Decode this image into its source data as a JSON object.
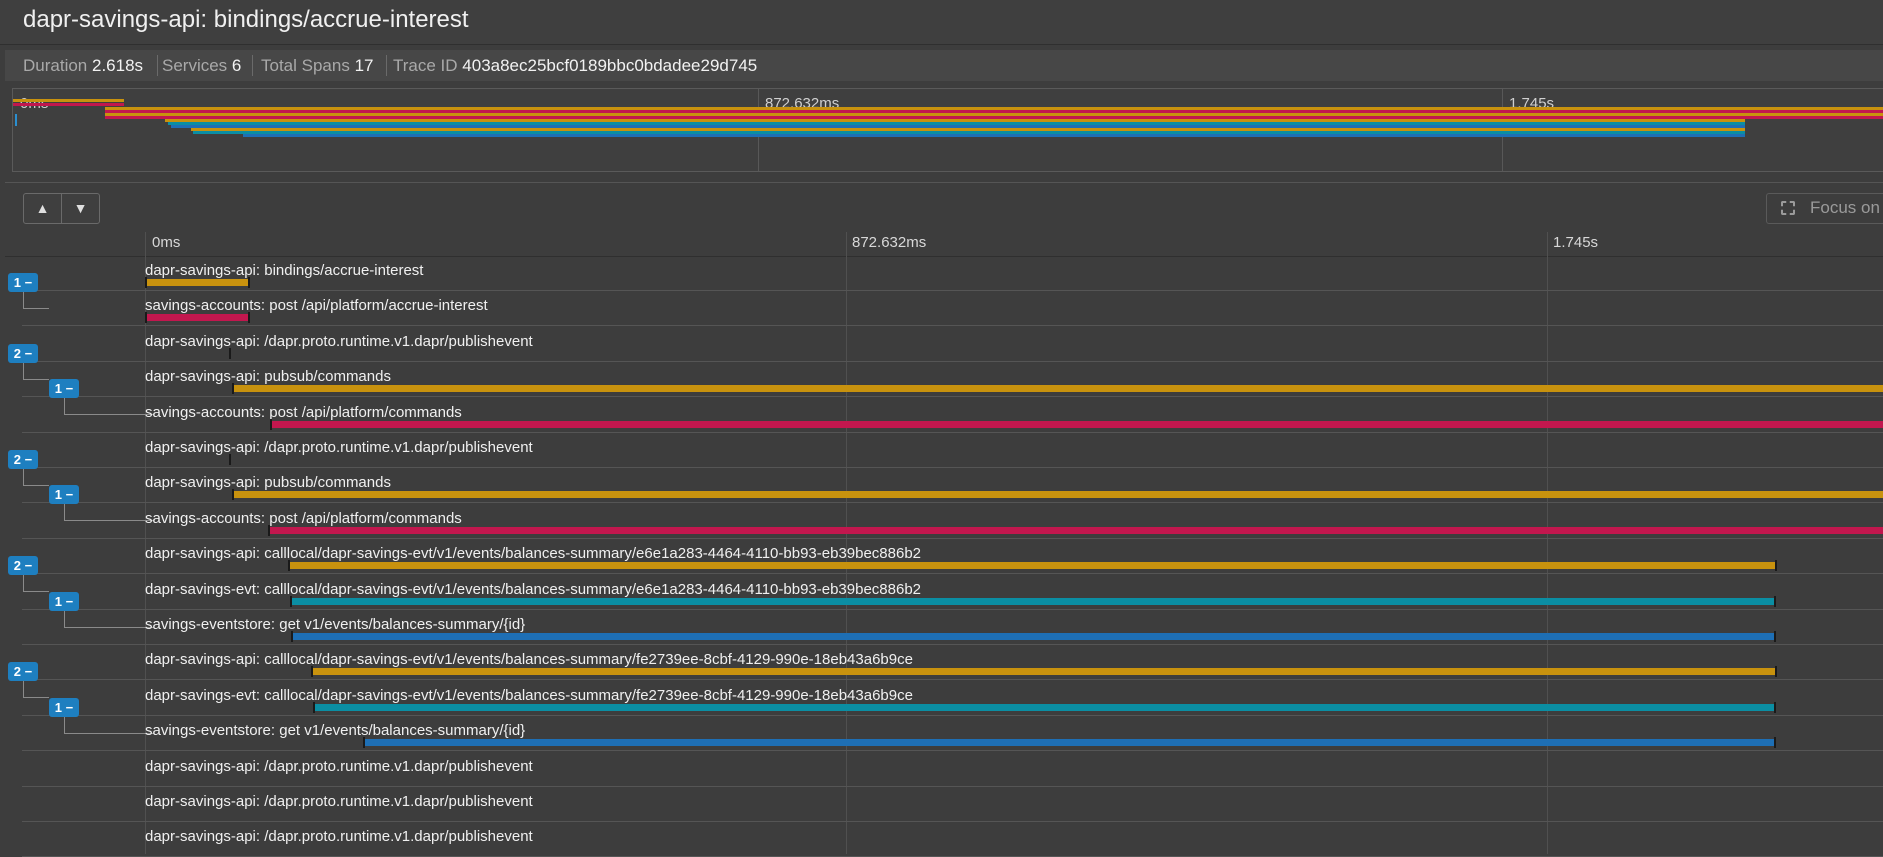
{
  "page_title": "dapr-savings-api: bindings/accrue-interest",
  "stats": {
    "duration_label": "Duration",
    "duration_value": "2.618s",
    "services_label": "Services",
    "services_value": "6",
    "spans_label": "Total Spans",
    "spans_value": "17",
    "trace_label": "Trace ID",
    "trace_value": "403a8ec25bcf0189bbc0bdadee29d745"
  },
  "ticks": [
    "0ms",
    "872.632ms",
    "1.745s"
  ],
  "focus_label": "Focus on",
  "service_colors": {
    "dapr-savings-api": "#c8920e",
    "savings-accounts": "#c2174e",
    "dapr-savings-evt": "#0b8ea3",
    "savings-eventstore": "#1e6fb5"
  },
  "rows": [
    {
      "name": "dapr-savings-api: bindings/accrue-interest",
      "service": "dapr-savings-api",
      "badge": "1 −"
    },
    {
      "name": "savings-accounts: post /api/platform/accrue-interest",
      "service": "savings-accounts"
    },
    {
      "name": "dapr-savings-api: /dapr.proto.runtime.v1.dapr/publishevent",
      "service": "dapr-savings-api",
      "badge": "2 −"
    },
    {
      "name": "dapr-savings-api: pubsub/commands",
      "service": "dapr-savings-api",
      "badge": "1 −"
    },
    {
      "name": "savings-accounts: post /api/platform/commands",
      "service": "savings-accounts"
    },
    {
      "name": "dapr-savings-api: /dapr.proto.runtime.v1.dapr/publishevent",
      "service": "dapr-savings-api",
      "badge": "2 −"
    },
    {
      "name": "dapr-savings-api: pubsub/commands",
      "service": "dapr-savings-api",
      "badge": "1 −"
    },
    {
      "name": "savings-accounts: post /api/platform/commands",
      "service": "savings-accounts"
    },
    {
      "name": "dapr-savings-api: calllocal/dapr-savings-evt/v1/events/balances-summary/e6e1a283-4464-4110-bb93-eb39bec886b2",
      "service": "dapr-savings-api",
      "badge": "2 −"
    },
    {
      "name": "dapr-savings-evt: calllocal/dapr-savings-evt/v1/events/balances-summary/e6e1a283-4464-4110-bb93-eb39bec886b2",
      "service": "dapr-savings-evt",
      "badge": "1 −"
    },
    {
      "name": "savings-eventstore: get v1/events/balances-summary/{id}",
      "service": "savings-eventstore"
    },
    {
      "name": "dapr-savings-api: calllocal/dapr-savings-evt/v1/events/balances-summary/fe2739ee-8cbf-4129-990e-18eb43a6b9ce",
      "service": "dapr-savings-api",
      "badge": "2 −"
    },
    {
      "name": "dapr-savings-evt: calllocal/dapr-savings-evt/v1/events/balances-summary/fe2739ee-8cbf-4129-990e-18eb43a6b9ce",
      "service": "dapr-savings-evt",
      "badge": "1 −"
    },
    {
      "name": "savings-eventstore: get v1/events/balances-summary/{id}",
      "service": "savings-eventstore"
    },
    {
      "name": "dapr-savings-api: /dapr.proto.runtime.v1.dapr/publishevent",
      "service": "dapr-savings-api"
    },
    {
      "name": "dapr-savings-api: /dapr.proto.runtime.v1.dapr/publishevent",
      "service": "dapr-savings-api"
    },
    {
      "name": "dapr-savings-api: /dapr.proto.runtime.v1.dapr/publishevent",
      "service": "dapr-savings-api"
    }
  ]
}
